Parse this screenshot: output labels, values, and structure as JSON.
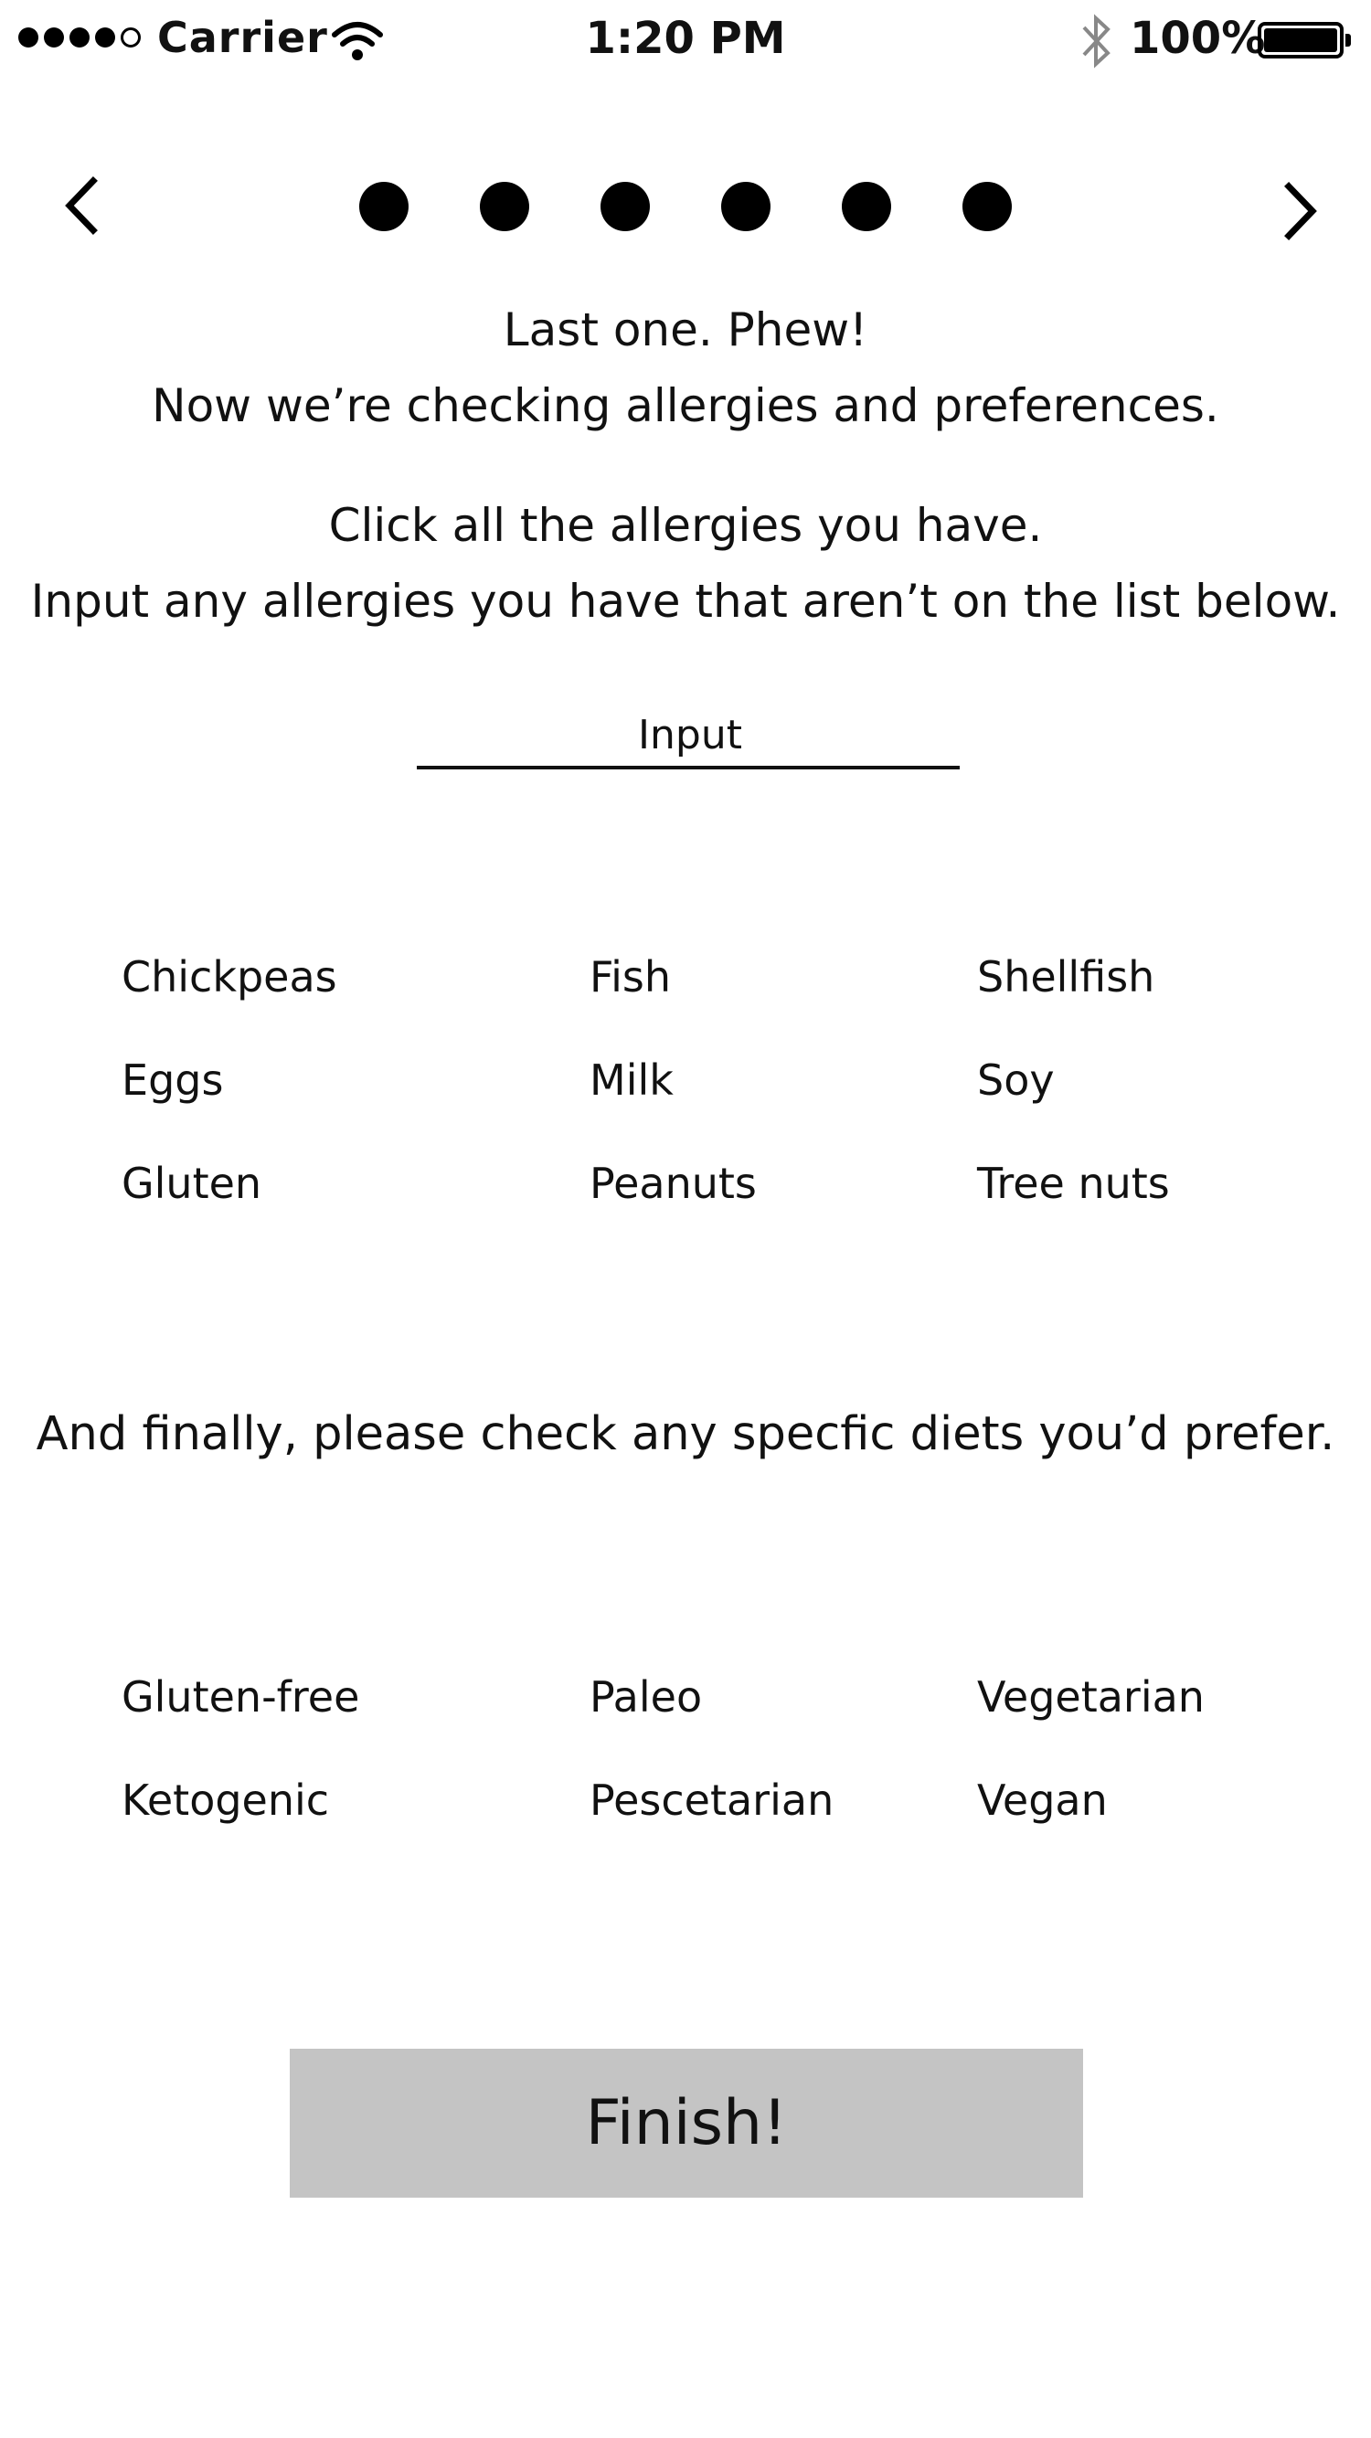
{
  "status_bar": {
    "carrier": "Carrier",
    "time": "1:20 PM",
    "battery": "100%",
    "icons": [
      "signal-icon",
      "wifi-icon",
      "bluetooth-icon",
      "battery-icon"
    ]
  },
  "nav": {
    "prev_icon": "chevron-left-icon",
    "next_icon": "chevron-right-icon",
    "progress_steps": 6
  },
  "intro": {
    "line1": "Last one. Phew!",
    "line2": "Now we’re checking allergies and preferences."
  },
  "allergy_instructions": {
    "line1": "Click all the allergies you  have.",
    "line2": "Input any allergies you have that aren’t on the list below."
  },
  "allergy_input": {
    "value": "",
    "placeholder": "Input"
  },
  "allergies": [
    "Chickpeas",
    "Fish",
    "Shellfish",
    "Eggs",
    "Milk",
    "Soy",
    "Gluten",
    "Peanuts",
    "Tree nuts"
  ],
  "diet_prompt": "And finally, please check any specfic diets you’d prefer.",
  "diets": [
    "Gluten-free",
    "Paleo",
    "Vegetarian",
    "Ketogenic",
    "Pescetarian",
    "Vegan"
  ],
  "finish_button": {
    "label": "Finish!",
    "color": "#c4c4c4"
  }
}
